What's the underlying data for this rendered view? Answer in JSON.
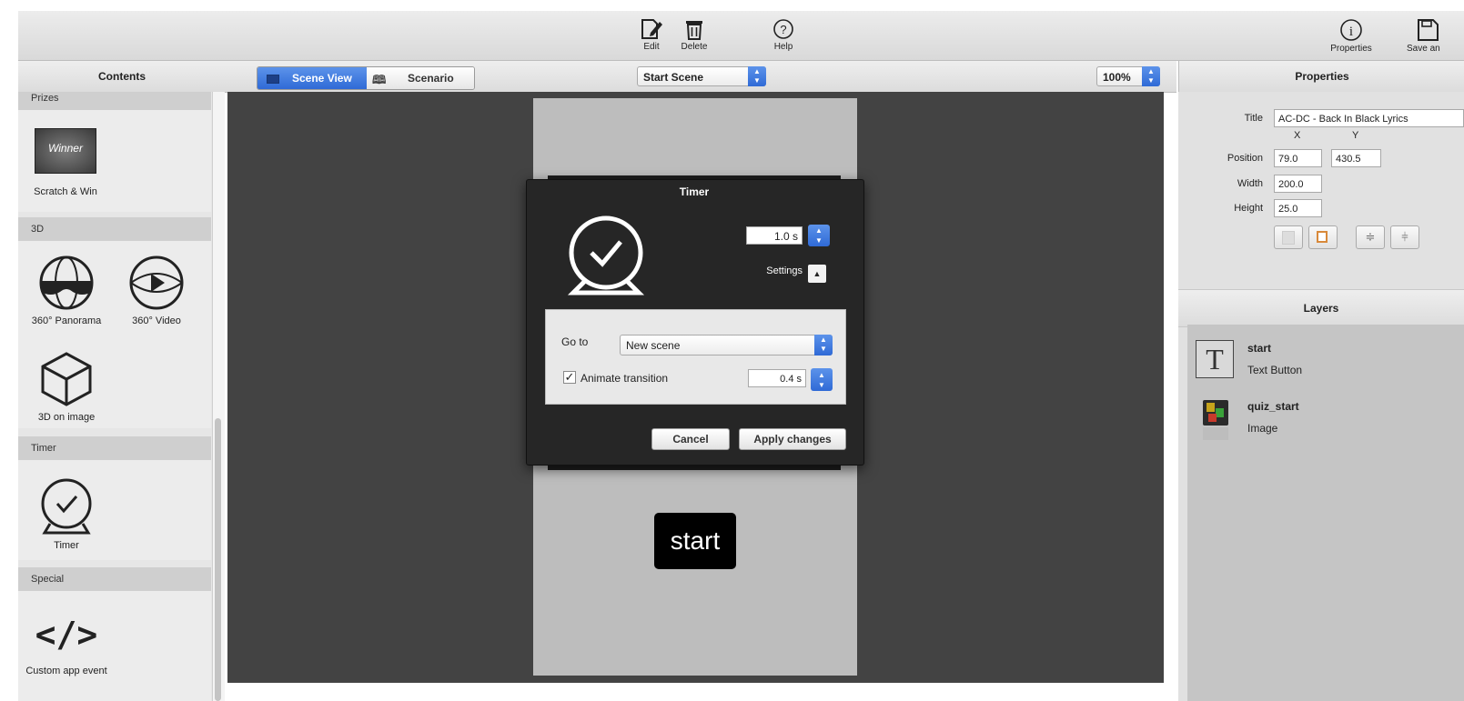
{
  "toolbar": {
    "edit_label": "Edit",
    "delete_label": "Delete",
    "help_label": "Help",
    "properties_label": "Properties",
    "save_label": "Save an"
  },
  "contents": {
    "title": "Contents",
    "prizes_header": "Prizes",
    "scratch_label": "Scratch & Win",
    "winner_text": "Winner",
    "header_3d": "3D",
    "panorama_label": "360° Panorama",
    "video_label": "360° Video",
    "image3d_label": "3D on image",
    "timer_header": "Timer",
    "timer_label": "Timer",
    "special_header": "Special",
    "custom_label": "Custom app event"
  },
  "view": {
    "scene_view": "Scene View",
    "scenario": "Scenario",
    "scene_select": "Start Scene",
    "zoom": "100%"
  },
  "dialog": {
    "title": "Timer",
    "duration": "1.0 s",
    "settings": "Settings",
    "goto_label": "Go to",
    "goto_value": "New scene",
    "animate_label": "Animate transition",
    "animate_checked": true,
    "animate_duration": "0.4 s",
    "cancel": "Cancel",
    "apply": "Apply changes"
  },
  "canvas": {
    "start_button": "start"
  },
  "properties": {
    "title": "Properties",
    "title_label": "Title",
    "title_value": "AC-DC - Back In Black Lyrics",
    "x_header": "X",
    "y_header": "Y",
    "position_label": "Position",
    "pos_x": "79.0",
    "pos_y": "430.5",
    "width_label": "Width",
    "width_value": "200.0",
    "height_label": "Height",
    "height_value": "25.0"
  },
  "layers": {
    "title": "Layers",
    "items": [
      {
        "name": "start",
        "type": "Text Button",
        "icon": "text-icon"
      },
      {
        "name": "quiz_start",
        "type": "Image",
        "icon": "image-thumbnail"
      }
    ]
  }
}
